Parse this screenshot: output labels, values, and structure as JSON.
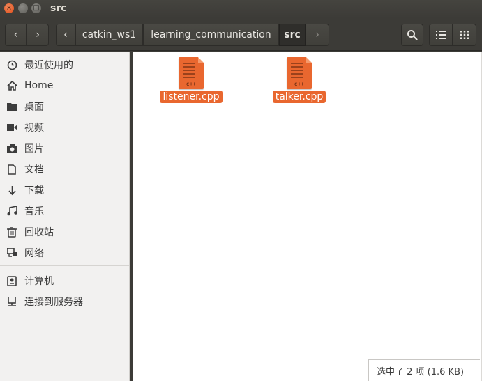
{
  "window": {
    "title": "src"
  },
  "pathbar": {
    "crumbs": [
      "catkin_ws1",
      "learning_communication",
      "src"
    ]
  },
  "sidebar": {
    "items": [
      {
        "label": "最近使用的",
        "icon": "clock-icon"
      },
      {
        "label": "Home",
        "icon": "home-icon"
      },
      {
        "label": "桌面",
        "icon": "folder-icon"
      },
      {
        "label": "视频",
        "icon": "video-icon"
      },
      {
        "label": "图片",
        "icon": "camera-icon"
      },
      {
        "label": "文档",
        "icon": "document-icon"
      },
      {
        "label": "下载",
        "icon": "download-icon"
      },
      {
        "label": "音乐",
        "icon": "music-icon"
      },
      {
        "label": "回收站",
        "icon": "trash-icon"
      },
      {
        "label": "网络",
        "icon": "network-icon"
      }
    ],
    "devices": [
      {
        "label": "计算机",
        "icon": "computer-icon"
      },
      {
        "label": "连接到服务器",
        "icon": "server-icon"
      }
    ]
  },
  "files": [
    {
      "name": "listener.cpp",
      "badge": "c++",
      "selected": true
    },
    {
      "name": "talker.cpp",
      "badge": "c++",
      "selected": true
    }
  ],
  "status": {
    "text": "选中了 2 项 (1.6 KB)"
  },
  "colors": {
    "accent": "#e9672f",
    "titlebar": "#3c3b37",
    "sidebar": "#f2f1f0"
  }
}
